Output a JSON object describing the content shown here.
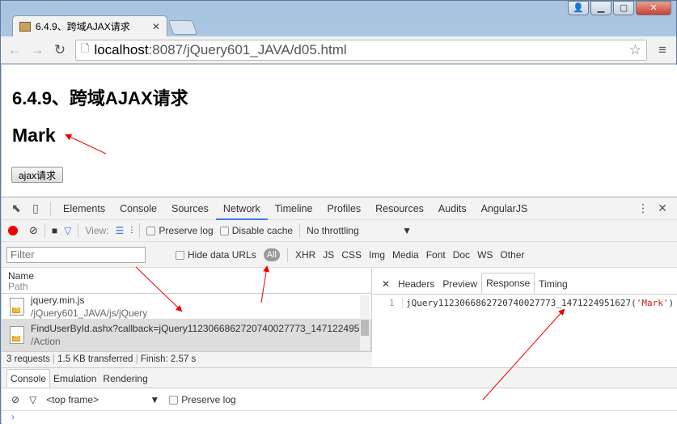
{
  "browser": {
    "tab_title": "6.4.9、跨域AJAX请求",
    "url_host": "localhost",
    "url_rest": ":8087/jQuery601_JAVA/d05.html"
  },
  "page": {
    "heading": "6.4.9、跨域AJAX请求",
    "result": "Mark",
    "button": "ajax请求"
  },
  "devtools": {
    "tabs": [
      "Elements",
      "Console",
      "Sources",
      "Network",
      "Timeline",
      "Profiles",
      "Resources",
      "Audits",
      "AngularJS"
    ],
    "active_tab": "Network",
    "toolbar": {
      "view_label": "View:",
      "preserve_log": "Preserve log",
      "disable_cache": "Disable cache",
      "throttling": "No throttling"
    },
    "filter": {
      "placeholder": "Filter",
      "hide_data_urls": "Hide data URLs",
      "types": [
        "All",
        "XHR",
        "JS",
        "CSS",
        "Img",
        "Media",
        "Font",
        "Doc",
        "WS",
        "Other"
      ]
    },
    "columns": {
      "name": "Name",
      "path": "Path"
    },
    "requests": [
      {
        "name": "jquery.min.js",
        "path": "/jQuery601_JAVA/js/jQuery"
      },
      {
        "name": "FindUserById.ashx?callback=jQuery1123066862720740027773_147122495...",
        "path": "/Action"
      }
    ],
    "status": {
      "requests": "3 requests",
      "transferred": "1.5 KB transferred",
      "finish": "Finish: 2.57 s"
    },
    "detail_tabs": [
      "Headers",
      "Preview",
      "Response",
      "Timing"
    ],
    "response": {
      "line": "1",
      "fn": "jQuery1123066862720740027773_1471224951627(",
      "arg": "'Mark'",
      "close": ")"
    },
    "drawer_tabs": [
      "Console",
      "Emulation",
      "Rendering"
    ],
    "console": {
      "frame": "<top frame>",
      "preserve_log": "Preserve log",
      "prompt": "›"
    }
  },
  "colors": {
    "accent": "#3b78e7",
    "record": "#ee0000",
    "annotation": "#e00000"
  }
}
